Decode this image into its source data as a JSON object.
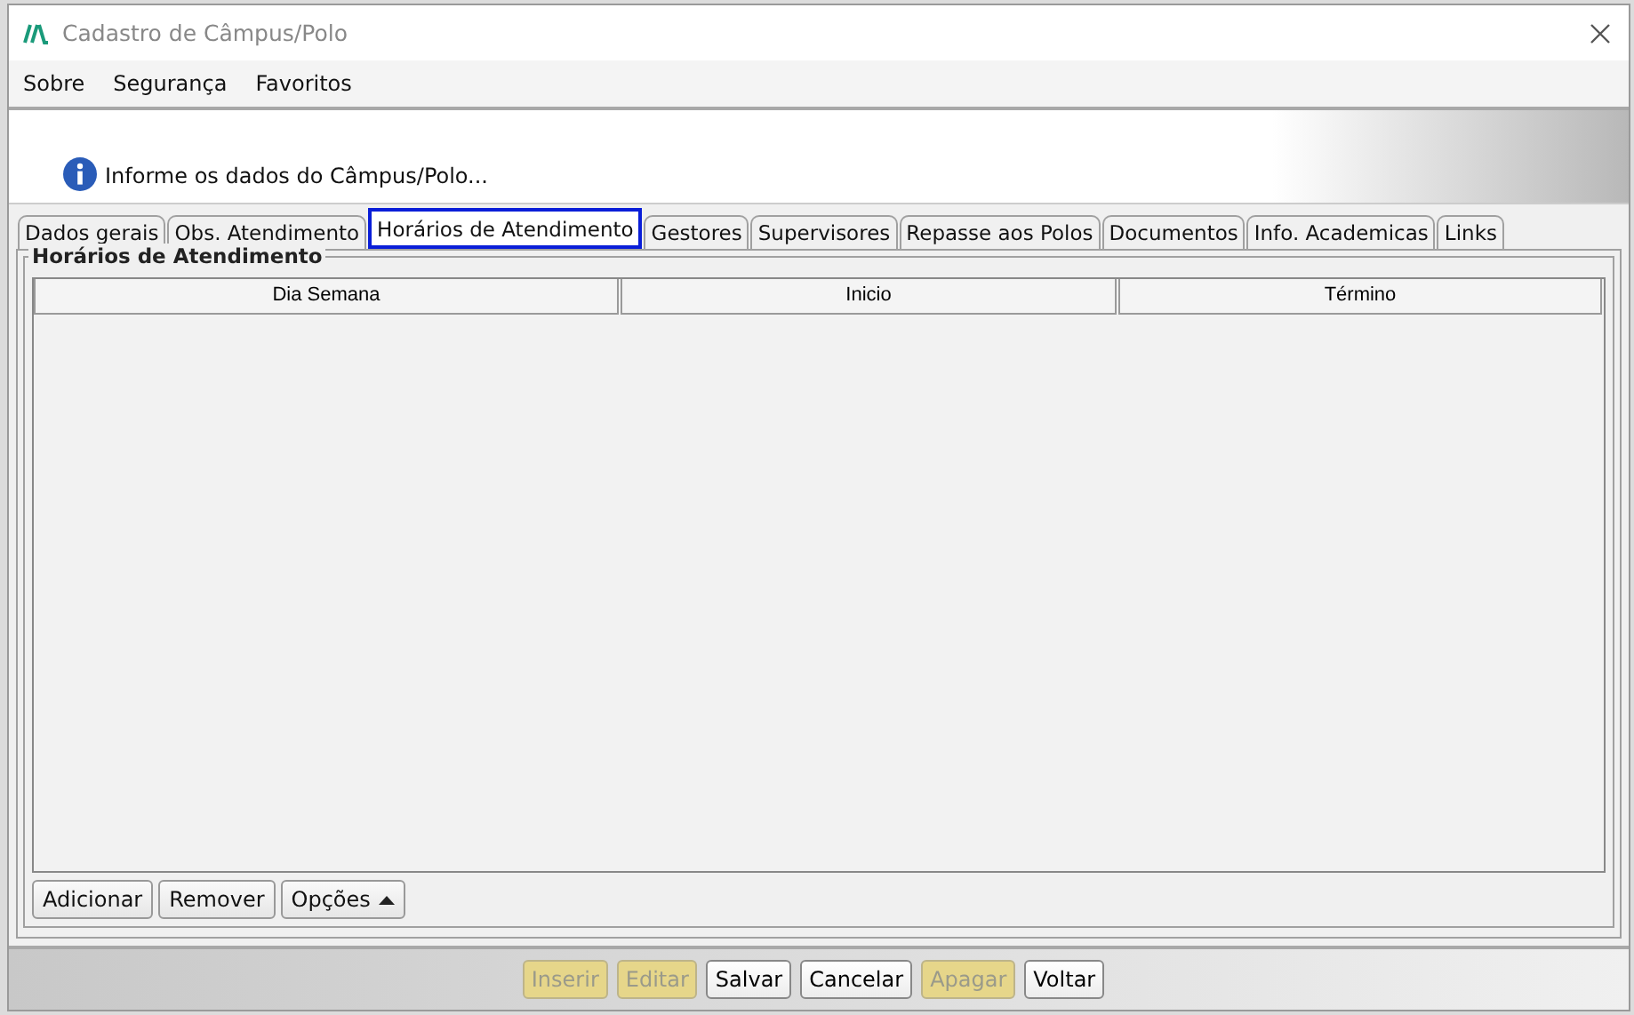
{
  "window": {
    "title": "Cadastro de Câmpus/Polo"
  },
  "menu": [
    "Sobre",
    "Segurança",
    "Favoritos"
  ],
  "header": {
    "message": "Informe os dados do Câmpus/Polo..."
  },
  "tabs": [
    {
      "label": "Dados gerais",
      "selected": false
    },
    {
      "label": "Obs. Atendimento",
      "selected": false
    },
    {
      "label": "Horários de Atendimento",
      "selected": true
    },
    {
      "label": "Gestores",
      "selected": false
    },
    {
      "label": "Supervisores",
      "selected": false
    },
    {
      "label": "Repasse aos Polos",
      "selected": false
    },
    {
      "label": "Documentos",
      "selected": false
    },
    {
      "label": "Info. Academicas",
      "selected": false
    },
    {
      "label": "Links",
      "selected": false
    }
  ],
  "group": {
    "title": "Horários de Atendimento",
    "table": {
      "columns": [
        "Dia Semana",
        "Inicio",
        "Término"
      ]
    },
    "buttons": [
      {
        "label": "Adicionar",
        "kind": "plain"
      },
      {
        "label": "Remover",
        "kind": "plain"
      },
      {
        "label": "Opções",
        "kind": "menu"
      }
    ]
  },
  "actions": [
    {
      "label": "Inserir",
      "disabled": true
    },
    {
      "label": "Editar",
      "disabled": true
    },
    {
      "label": "Salvar",
      "disabled": false
    },
    {
      "label": "Cancelar",
      "disabled": false
    },
    {
      "label": "Apagar",
      "disabled": true
    },
    {
      "label": "Voltar",
      "disabled": false
    }
  ]
}
